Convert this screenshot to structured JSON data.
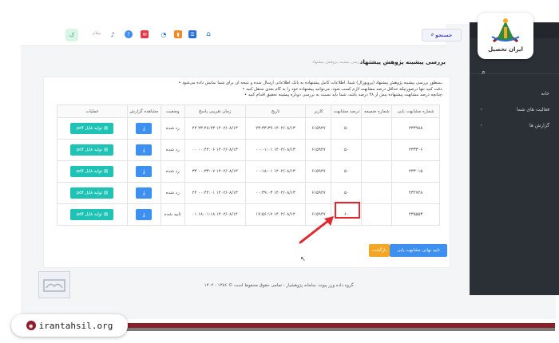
{
  "header": {
    "search_label": "جستجو",
    "user_label": "سلام",
    "avatar_label": "ک"
  },
  "sidebar": {
    "items": [
      {
        "label": "خانه"
      },
      {
        "label": "فعالیت های شما"
      },
      {
        "label": "گزارش ها"
      }
    ]
  },
  "page": {
    "title": "بررسی پیشینه پژوهش پیشنهاد",
    "breadcrumb": "خانه  ›  بررسی پیشینه پژوهش پیشنهاد"
  },
  "notes": [
    "• بمنظور بررسی پیشینه پژوهش پیشنهاد (پروپوزال) شما، اطلاعات کامل پیشنهاده به بانک اطلاعاتی ارسال شده و نتیجه آن برای شما نمایش داده می‌شود.",
    "• دقت کنید تنها درصورتیکه حداقل درصد مشابهت لازم کسب شود، می‌توانید پیشنهاده خود را به گام بعدی منتقل کنید.",
    "• چنانچه درصد مشابهت پیشنهاده بیش از ۴۸ درصد باشد، شما باید نسبت به بررسی دوباره پیشینه تحقیق اقدام کنید."
  ],
  "table": {
    "headers": [
      "شماره مشابهت یابی",
      "شماره ضمیمه",
      "درصد مشابهت",
      "کاربر",
      "تاریخ",
      "زمان تقریبی پاسخ",
      "وضعیت",
      "مشاهده گزارش",
      "عملیات"
    ],
    "rows": [
      {
        "id": "۴۳۳۹۸۸",
        "attach": "",
        "percent": "۵۰",
        "user": "۶۱۵۹۴۷",
        "date": "۱۴۰۲/۰۸/۱۳ ۲۳:۳۳:۳۹",
        "response": "۱۴۰۲/۰۸/۱۳ ۲۳:۴۸:۲۳ ۴۴",
        "status": "رد شده",
        "pdf_label": "تولید فایل pdf"
      },
      {
        "id": "۴۳۳۳۰۶",
        "attach": "",
        "percent": "۵۰",
        "user": "۶۱۵۹۴۷",
        "date": "۱۴۰۲/۰۸/۱۳ ۰۰:۰۱:۰۱",
        "response": "۱۴۰۲/۰۸/۱۳ ۰۰:۴۴:۰۶ ۰۰",
        "status": "رد شده",
        "pdf_label": "تولید فایل pdf"
      },
      {
        "id": "۴۳۳۰۱۵",
        "attach": "",
        "percent": "۵۰",
        "user": "۶۱۵۹۴۷",
        "date": "۱۴۰۲/۰۸/۱۳ ۰۰:۱۸:۰۱",
        "response": "۱۴۰۲/۰۸/۱۳ ۰۰:۳۳:۰۷ ۳۳",
        "status": "رد شده",
        "pdf_label": "تولید فایل pdf"
      },
      {
        "id": "۴۳۲۷۲۸",
        "attach": "",
        "percent": "۵۰",
        "user": "۶۱۵۹۴۷",
        "date": "۱۴۰۲/۰۸/۱۳ ۰۰:۳۹:۰۳",
        "response": "۱۴۰۲/۰۸/۱۳ ۰۰:۴۴:۰۱ ۴۴",
        "status": "رد شده",
        "pdf_label": "تولید فایل pdf"
      },
      {
        "id": "۴۳۵۵۵۳",
        "attach": "",
        "percent": "۶۰",
        "user": "۶۱۵۹۴۷",
        "date": "۱۴۰۲/۰۸/۱۴ ۱۷:۵۶:۱۷",
        "response": "۱۴۰۲/۰۸/۱۴ ۱۸:۰۱:۱۸ ۰۱",
        "status": "تایید شده",
        "pdf_label": "تولید فایل pdf"
      }
    ]
  },
  "actions": {
    "final_label": "تایید نهایی مشابهت یابی",
    "back_label": "بازگشت"
  },
  "footer": "۱۴۰۲ - ۱۳۸۶ © گروه داده ورز پیوند، سامانه پژوهشیار - تمامی حقوق محفوظ است.",
  "branding": {
    "logo_name": "ایران تحصیل",
    "site_url": "irantahsil.org"
  },
  "colors": {
    "accent_blue": "#3d8ff0",
    "teal": "#1ec3b5",
    "highlight_red": "#e0282e",
    "brand_maroon": "#8c1d2a",
    "sidebar": "#2b2f36"
  }
}
